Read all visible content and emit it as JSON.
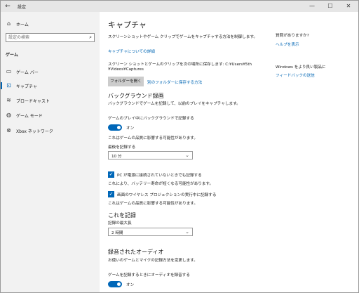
{
  "window": {
    "title": "設定",
    "back_icon": "←",
    "minimize": "—",
    "maximize": "☐",
    "close": "✕"
  },
  "sidebar": {
    "home": {
      "icon": "⌂",
      "label": "ホーム"
    },
    "search": {
      "placeholder": "設定の検索",
      "icon": "⌕"
    },
    "section": "ゲーム",
    "items": [
      {
        "icon": "▭",
        "label": "ゲーム バー"
      },
      {
        "icon": "⊡",
        "label": "キャプチャ"
      },
      {
        "icon": "≋",
        "label": "ブロードキャスト"
      },
      {
        "icon": "◍",
        "label": "ゲーム モード"
      },
      {
        "icon": "⊗",
        "label": "Xbox ネットワーク"
      }
    ]
  },
  "main": {
    "title": "キャプチャ",
    "intro": "スクリーンショットやゲーム クリップでゲームをキャプチャする方法を制御します。",
    "capture_details_link": "キャプチャについての詳細",
    "save_text_1": "スクリーン ショットとゲームのクリップを次の場所に保存します: C:¥Users¥5th",
    "save_text_2": "¥Videos¥Captures",
    "open_folder_button": "フォルダーを開く",
    "save_other_folder_link": "別のフォルダーに保存する方法",
    "bg_recording": {
      "title": "バックグラウンド録画",
      "desc": "バックグラウンドでゲームを記録して、以前のプレイをキャプチャします。",
      "toggle_label": "ゲームのプレイ中にバックグラウンドで記録する",
      "toggle_state": "オン",
      "impact_note": "これはゲームの品質に影響する可能性があります。",
      "last_label": "最後を記録する",
      "last_value": "10 分",
      "chk1": "PC が電源に接続されていないときでも記録する",
      "chk1_note": "これにより、バッテリー寿命が短くなる可能性があります。",
      "chk2": "画面のワイヤレス プロジェクションの実行中に記録する",
      "chk2_note": "これはゲームの品質に影響する可能性があります。"
    },
    "record_this": {
      "title": "これを記録",
      "max_label": "記録の最大長",
      "max_value": "2 時間"
    },
    "recorded_audio": {
      "title": "録音されたオーディオ",
      "desc": "お使いのゲームとマイクの記録方法を変更します。",
      "toggle_label": "ゲームを記録するときにオーディオを録音する",
      "toggle_state": "オン"
    }
  },
  "right": {
    "question": "質問がありますか?",
    "help_link": "ヘルプを表示",
    "improve": "Windows をより良い製品に",
    "feedback_link": "フィードバックの送信"
  },
  "colors": {
    "accent": "#0067b8",
    "link": "#0066b4",
    "sidebar_bg": "#f2f2f2",
    "titlebar_bg": "#e6e6e6"
  }
}
